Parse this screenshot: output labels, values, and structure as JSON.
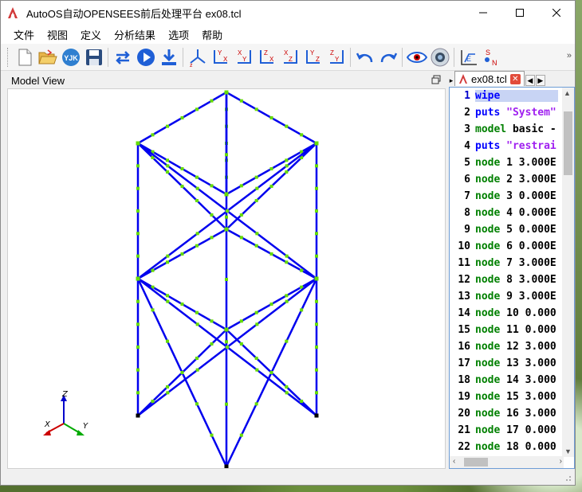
{
  "window": {
    "title": "AutoOS自动OPENSEES前后处理平台 ex08.tcl"
  },
  "menubar": {
    "items": [
      "文件",
      "视图",
      "定义",
      "分析结果",
      "选项",
      "帮助"
    ]
  },
  "toolbar": {
    "buttons": [
      "new-file",
      "open-folder",
      "yjk-import",
      "save",
      "refresh",
      "run",
      "download",
      "view-3d",
      "view-yx",
      "view-xy",
      "view-zx",
      "view-xz",
      "view-yz",
      "view-zy",
      "undo",
      "redo",
      "eye",
      "camera",
      "extrude",
      "snap"
    ],
    "yjk_label": "YJK"
  },
  "model_view": {
    "title": "Model View",
    "axes": {
      "x": "X",
      "y": "Y",
      "z": "Z"
    }
  },
  "editor": {
    "tab_label": "ex08.tcl",
    "lines": [
      {
        "n": "1",
        "kw": "wipe",
        "rest": ""
      },
      {
        "n": "2",
        "kw": "puts",
        "rest": " \"System\""
      },
      {
        "n": "3",
        "kw": "model",
        "rest": " basic -"
      },
      {
        "n": "4",
        "kw": "puts",
        "rest": " \"restrai"
      },
      {
        "n": "5",
        "kw": "node",
        "rest": " 1 3.000E"
      },
      {
        "n": "6",
        "kw": "node",
        "rest": " 2 3.000E"
      },
      {
        "n": "7",
        "kw": "node",
        "rest": " 3 0.000E"
      },
      {
        "n": "8",
        "kw": "node",
        "rest": " 4 0.000E"
      },
      {
        "n": "9",
        "kw": "node",
        "rest": " 5 0.000E"
      },
      {
        "n": "10",
        "kw": "node",
        "rest": " 6 0.000E"
      },
      {
        "n": "11",
        "kw": "node",
        "rest": " 7 3.000E"
      },
      {
        "n": "12",
        "kw": "node",
        "rest": " 8 3.000E"
      },
      {
        "n": "13",
        "kw": "node",
        "rest": " 9 3.000E"
      },
      {
        "n": "14",
        "kw": "node",
        "rest": " 10 0.000"
      },
      {
        "n": "15",
        "kw": "node",
        "rest": " 11 0.000"
      },
      {
        "n": "16",
        "kw": "node",
        "rest": " 12 3.000"
      },
      {
        "n": "17",
        "kw": "node",
        "rest": " 13 3.000"
      },
      {
        "n": "18",
        "kw": "node",
        "rest": " 14 3.000"
      },
      {
        "n": "19",
        "kw": "node",
        "rest": " 15 3.000"
      },
      {
        "n": "20",
        "kw": "node",
        "rest": " 16 3.000"
      },
      {
        "n": "21",
        "kw": "node",
        "rest": " 17 0.000"
      },
      {
        "n": "22",
        "kw": "node",
        "rest": " 18 0.000"
      }
    ]
  },
  "colors": {
    "member": "#0000ee",
    "node": "#66dd00",
    "axis_x": "#cc0000",
    "axis_y": "#00aa00",
    "axis_z": "#0000cc"
  }
}
